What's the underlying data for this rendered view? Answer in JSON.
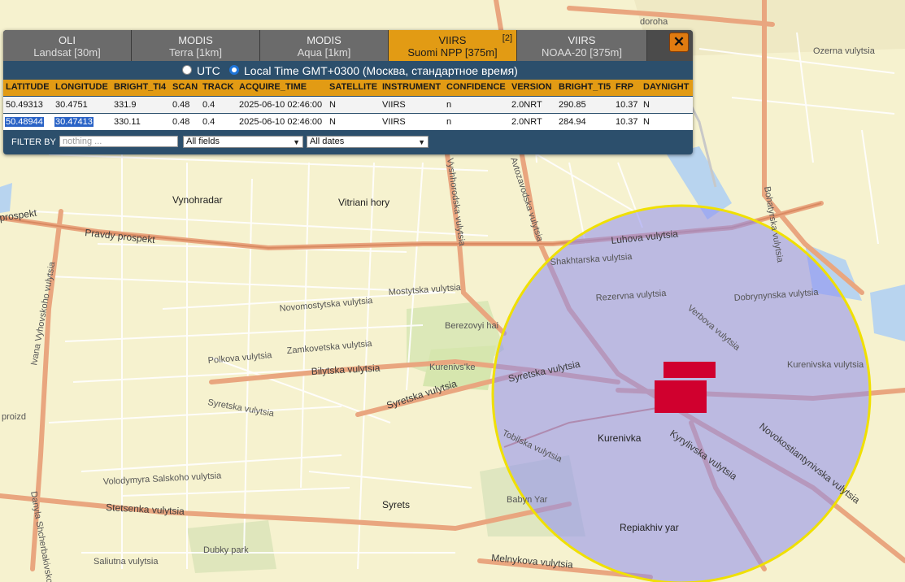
{
  "tabs": [
    {
      "line1": "OLI",
      "line2": "Landsat [30m]",
      "active": false
    },
    {
      "line1": "MODIS",
      "line2": "Terra [1km]",
      "active": false
    },
    {
      "line1": "MODIS",
      "line2": "Aqua [1km]",
      "active": false
    },
    {
      "line1": "VIIRS",
      "line2": "Suomi NPP [375m]",
      "active": true,
      "badge": "[2]"
    },
    {
      "line1": "VIIRS",
      "line2": "NOAA-20 [375m]",
      "active": false
    }
  ],
  "close_label": "✕",
  "timezone": {
    "utc_label": "UTC",
    "local_label": "Local Time GMT+0300 (Москва, стандартное время)",
    "selected": "local"
  },
  "table": {
    "columns": [
      "LATITUDE",
      "LONGITUDE",
      "BRIGHT_TI4",
      "SCAN",
      "TRACK",
      "ACQUIRE_TIME",
      "SATELLITE",
      "INSTRUMENT",
      "CONFIDENCE",
      "VERSION",
      "BRIGHT_TI5",
      "FRP",
      "DAYNIGHT"
    ],
    "rows": [
      [
        "50.49313",
        "30.4751",
        "331.9",
        "0.48",
        "0.4",
        "2025-06-10 02:46:00",
        "N",
        "VIIRS",
        "n",
        "2.0NRT",
        "290.85",
        "10.37",
        "N"
      ],
      [
        "50.48944",
        "30.47413",
        "330.11",
        "0.48",
        "0.4",
        "2025-06-10 02:46:00",
        "N",
        "VIIRS",
        "n",
        "2.0NRT",
        "284.94",
        "10.37",
        "N"
      ]
    ]
  },
  "filter": {
    "label": "FILTER BY",
    "placeholder": "nothing ...",
    "fields_selected": "All fields",
    "dates_selected": "All dates"
  },
  "map": {
    "labels": {
      "vynohradar": "Vynohradar",
      "vitriani": "Vitriani hory",
      "prospekt": "prospekt",
      "pravdy": "Pravdy prospekt",
      "vyhovskoho": "Ivana Vyhovskoho vulytsia",
      "vyshhorodska": "Vyshhorodska vulytsia",
      "avtozavodska": "Avtozavodska vulytsia",
      "luhova": "Luhova vulytsia",
      "shakhtarska": "Shakhtarska vulytsia",
      "rezervna": "Rezervna vulytsia",
      "verbova": "Verbova vulytsia",
      "dobrynynska": "Dobrynynska vulytsia",
      "bohatyrska": "Bohatyrska vulytsia",
      "mostytska": "Mostytska vulytsia",
      "novomostytska": "Novomostytska vulytsia",
      "berezovyi": "Berezovyi hai",
      "zamkovetska": "Zamkovetska vulytsia",
      "polkova": "Polkova vulytsia",
      "bilytska": "Bilytska vulytsia",
      "kurenivske": "Kurenivs'ke",
      "syretska1": "Syretska vulytsia",
      "syretska2": "Syretska vulytsia",
      "syretska3": "Syretska vulytsia",
      "kurenivska": "Kurenivska vulytsia",
      "kurenivka": "Kurenivka",
      "kyrylivska": "Kyrylivska vulytsia",
      "novokostiantynivska": "Novokostiantynivska vulytsia",
      "tobilska": "Tobilska vulytsia",
      "volodymyra": "Volodymyra Salskoho vulytsia",
      "stetsenka": "Stetsenka vulytsia",
      "syrets": "Syrets",
      "babyn": "Babyn Yar",
      "repiakhiv": "Repiakhiv yar",
      "dubky": "Dubky park",
      "saliutna": "Saliutna vulytsia",
      "melnykova": "Melnykova vulytsia",
      "danyla": "Danyla Shcherbakivskoho",
      "proizd": "proizd",
      "ozerna": "Ozerna vulytsia",
      "doroha": "doroha"
    },
    "colors": {
      "land": "#f6f2cf",
      "road_major": "#e8a07e",
      "road_minor": "#ffffff",
      "highlight_circle": "#8c8cf0",
      "circle_border": "#f0e000",
      "fire": "#d0002e",
      "water": "#a8c8f0",
      "park": "#d8e8b0"
    }
  }
}
